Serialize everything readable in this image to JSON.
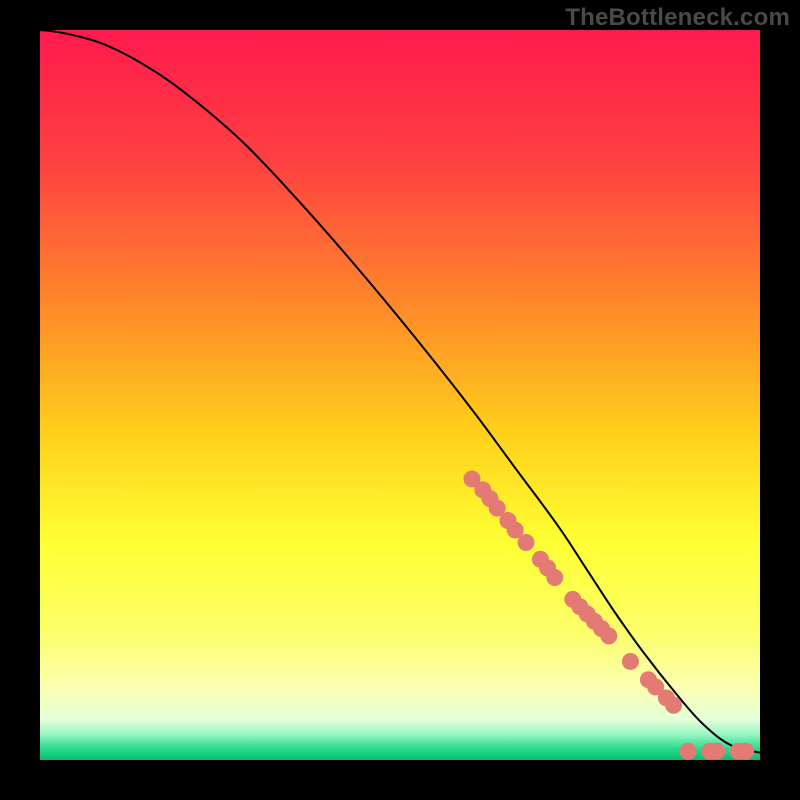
{
  "watermark": "TheBottleneck.com",
  "colors": {
    "frame": "#000000",
    "watermark_text": "#4a4a4a",
    "curve": "#000000",
    "marker_fill": "#e47a74",
    "marker_stroke": "#b84e48",
    "gradient_stops": [
      {
        "offset": 0.0,
        "color": "#ff1a4e"
      },
      {
        "offset": 0.18,
        "color": "#ff4040"
      },
      {
        "offset": 0.38,
        "color": "#ff8a2a"
      },
      {
        "offset": 0.55,
        "color": "#ffcf1a"
      },
      {
        "offset": 0.7,
        "color": "#ffff33"
      },
      {
        "offset": 0.82,
        "color": "#fcff66"
      },
      {
        "offset": 0.9,
        "color": "#fbffb0"
      },
      {
        "offset": 0.945,
        "color": "#e4ffd8"
      },
      {
        "offset": 0.965,
        "color": "#97f5c4"
      },
      {
        "offset": 0.985,
        "color": "#27d98a"
      },
      {
        "offset": 1.0,
        "color": "#02c06e"
      }
    ]
  },
  "chart_data": {
    "type": "line",
    "xlabel": "",
    "ylabel": "",
    "xlim": [
      0,
      100
    ],
    "ylim": [
      0,
      100
    ],
    "title": "",
    "series": [
      {
        "name": "curve",
        "x": [
          0,
          2,
          5,
          9,
          14,
          20,
          28,
          36,
          44,
          52,
          60,
          66,
          72,
          76,
          80,
          84,
          88,
          92,
          96,
          100
        ],
        "y": [
          100,
          99.8,
          99.2,
          98.0,
          95.5,
          91.5,
          84.8,
          76.5,
          67.5,
          58.0,
          48.0,
          40.0,
          32.0,
          26.0,
          20.0,
          14.5,
          9.5,
          5.0,
          2.0,
          1.0
        ]
      }
    ],
    "markers": {
      "name": "points",
      "x": [
        60,
        61.5,
        62.5,
        63.5,
        65,
        66,
        67.5,
        69.5,
        70.5,
        71.5,
        74,
        75,
        76,
        77,
        78,
        79,
        82,
        84.5,
        85.5,
        87,
        88,
        90,
        93,
        94,
        97,
        98
      ],
      "y": [
        38.5,
        37.0,
        35.8,
        34.5,
        32.8,
        31.5,
        29.8,
        27.5,
        26.3,
        25.0,
        22.0,
        21.0,
        20.0,
        19.0,
        18.0,
        17.0,
        13.5,
        11.0,
        10.0,
        8.5,
        7.5,
        1.2,
        1.2,
        1.2,
        1.2,
        1.2
      ]
    }
  }
}
